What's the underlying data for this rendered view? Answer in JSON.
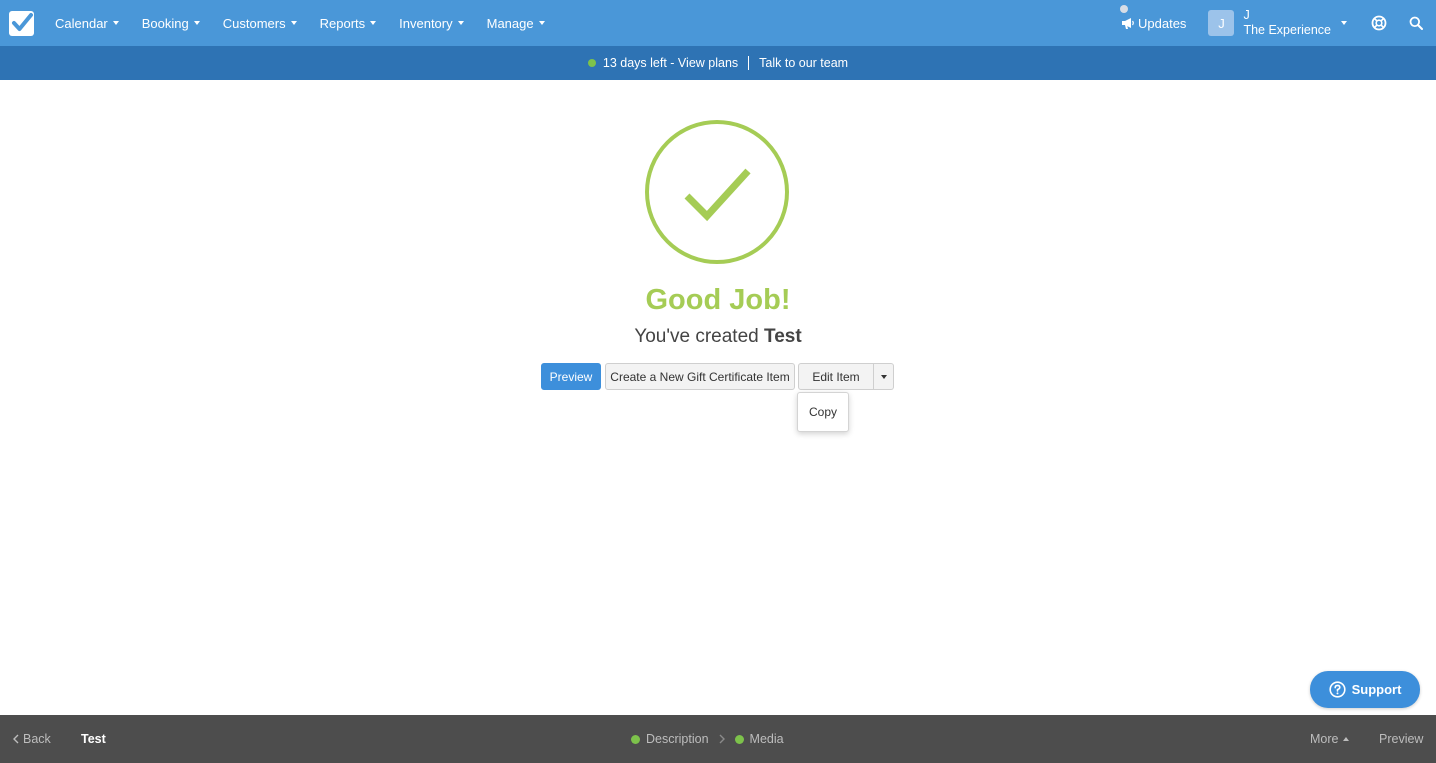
{
  "nav": {
    "items": [
      {
        "label": "Calendar",
        "name": "nav-calendar"
      },
      {
        "label": "Booking",
        "name": "nav-booking"
      },
      {
        "label": "Customers",
        "name": "nav-customers"
      },
      {
        "label": "Reports",
        "name": "nav-reports"
      },
      {
        "label": "Inventory",
        "name": "nav-inventory"
      },
      {
        "label": "Manage",
        "name": "nav-manage"
      }
    ],
    "updates_label": "Updates",
    "account": {
      "initial": "J",
      "name": "J",
      "company": "The Experience"
    }
  },
  "trial": {
    "days_left": "13 days left - View plans",
    "talk": "Talk to our team"
  },
  "success": {
    "title": "Good Job!",
    "subtitle_prefix": "You've created ",
    "item_name": "Test"
  },
  "actions": {
    "preview": "Preview",
    "create": "Create a New Gift Certificate Item",
    "edit": "Edit Item",
    "dropdown_copy": "Copy"
  },
  "support": {
    "label": "Support"
  },
  "footer": {
    "back": "Back",
    "title": "Test",
    "steps": [
      "Description",
      "Media"
    ],
    "more": "More",
    "preview": "Preview"
  },
  "colors": {
    "nav_bg": "#4a97d8",
    "trial_bg": "#2e73b4",
    "success_green": "#a5cc55",
    "primary": "#3d8fdb",
    "footer_bg": "#4d4d4d",
    "step_dot": "#7dc24b"
  }
}
